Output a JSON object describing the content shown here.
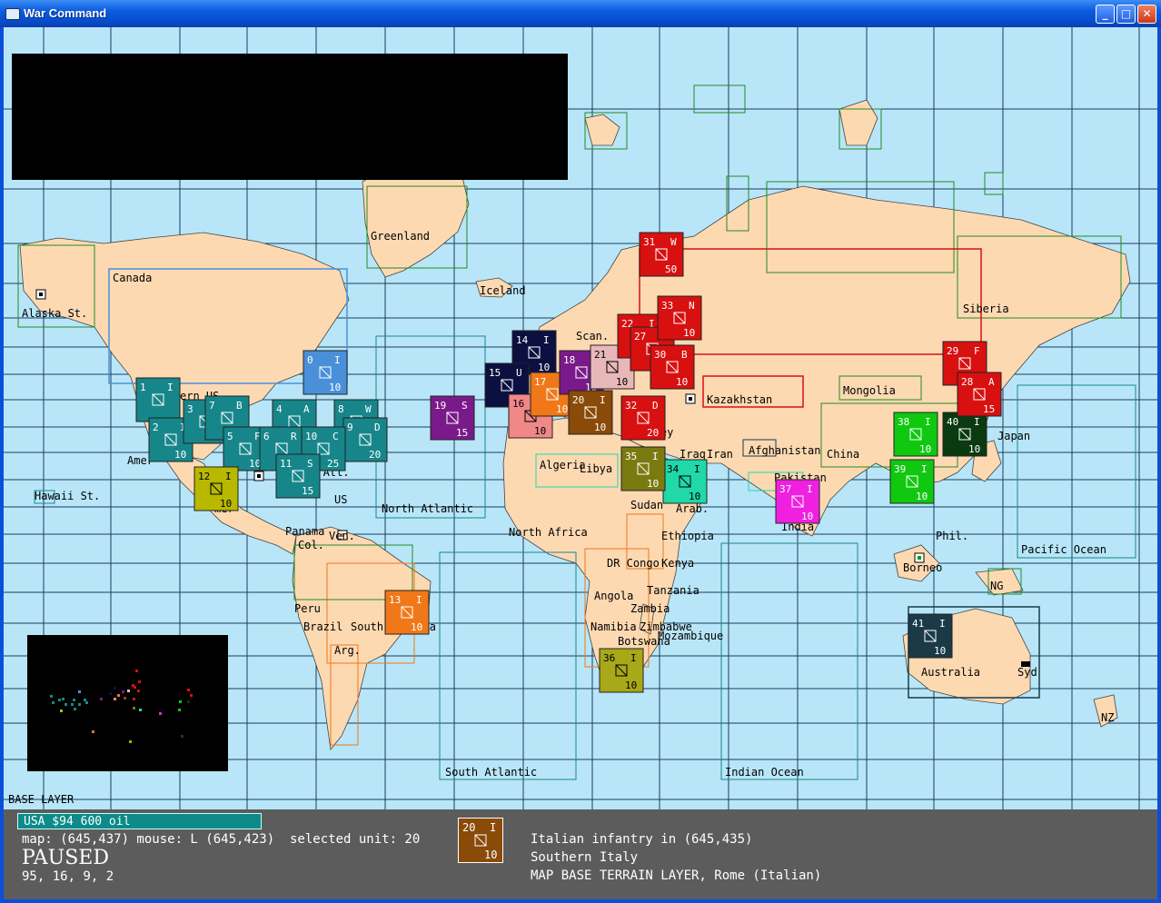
{
  "window": {
    "title": "War Command",
    "minimize": "_",
    "maximize": "□",
    "close": "✕",
    "icon": "app-window-icon"
  },
  "map": {
    "layer_label": "BASE LAYER",
    "regions": [
      "Greenland",
      "Iceland",
      "Canada",
      "Alaska St.",
      "Hawaii St.",
      "Siberia",
      "Mongolia",
      "Kazakhstan",
      "China",
      "Japan",
      "Scan.",
      "Algeria",
      "Libya",
      "Turkey",
      "Iraq",
      "Iran",
      "Afghanistan",
      "Pakistan",
      "India",
      "Arab.",
      "Sudan",
      "North Africa",
      "Ethiopia",
      "DR Congo",
      "Kenya",
      "Tanzania",
      "Angola",
      "Zambia",
      "Namibia",
      "Zimbabwe",
      "Botswana",
      "Mozambique",
      "Cuba",
      "US",
      "Panama",
      "Ven.",
      "Col.",
      "Peru",
      "Brazil",
      "South America",
      "Arg.",
      "Phil.",
      "Borneo",
      "NG",
      "Australia",
      "Syd",
      "NZ",
      "North Atlantic",
      "South Atlantic",
      "Indian Ocean",
      "Pacific Ocean",
      "st Atl.",
      "ern US",
      "Amer",
      "mer"
    ],
    "units": [
      {
        "id": "0",
        "type": "I",
        "strength": "10",
        "color": "#4a90d9"
      },
      {
        "id": "1",
        "type": "I",
        "strength": "",
        "color": "#17868a"
      },
      {
        "id": "2",
        "type": "I",
        "strength": "10",
        "color": "#17868a"
      },
      {
        "id": "3",
        "type": "",
        "strength": "",
        "color": "#17868a"
      },
      {
        "id": "7",
        "type": "B",
        "strength": "10",
        "color": "#17868a"
      },
      {
        "id": "5",
        "type": "F",
        "strength": "10",
        "color": "#17868a"
      },
      {
        "id": "4",
        "type": "A",
        "strength": "",
        "color": "#17868a"
      },
      {
        "id": "6",
        "type": "R",
        "strength": "10",
        "color": "#17868a"
      },
      {
        "id": "8",
        "type": "W",
        "strength": "",
        "color": "#17868a"
      },
      {
        "id": "9",
        "type": "D",
        "strength": "20",
        "color": "#17868a"
      },
      {
        "id": "10",
        "type": "C",
        "strength": "25",
        "color": "#17868a"
      },
      {
        "id": "11",
        "type": "S",
        "strength": "15",
        "color": "#17868a"
      },
      {
        "id": "12",
        "type": "I",
        "strength": "10",
        "color": "#b8b800"
      },
      {
        "id": "13",
        "type": "I",
        "strength": "10",
        "color": "#f07818"
      },
      {
        "id": "14",
        "type": "I",
        "strength": "10",
        "color": "#0c1040"
      },
      {
        "id": "15",
        "type": "U",
        "strength": "50",
        "color": "#0c1040"
      },
      {
        "id": "16",
        "type": "I",
        "strength": "10",
        "color": "#f08888"
      },
      {
        "id": "17",
        "type": "A",
        "strength": "10",
        "color": "#f07818"
      },
      {
        "id": "18",
        "type": "I",
        "strength": "10",
        "color": "#7a1a8a"
      },
      {
        "id": "19",
        "type": "S",
        "strength": "15",
        "color": "#7a1a8a"
      },
      {
        "id": "20",
        "type": "I",
        "strength": "10",
        "color": "#8a4a08"
      },
      {
        "id": "21",
        "type": "I",
        "strength": "10",
        "color": "#e8b8b8"
      },
      {
        "id": "22",
        "type": "I",
        "strength": "",
        "color": "#d81010"
      },
      {
        "id": "27",
        "type": "I",
        "strength": "",
        "color": "#d81010"
      },
      {
        "id": "30",
        "type": "B",
        "strength": "10",
        "color": "#d81010"
      },
      {
        "id": "31",
        "type": "W",
        "strength": "50",
        "color": "#d81010"
      },
      {
        "id": "32",
        "type": "D",
        "strength": "20",
        "color": "#d81010"
      },
      {
        "id": "33",
        "type": "N",
        "strength": "10",
        "color": "#d81010"
      },
      {
        "id": "34",
        "type": "I",
        "strength": "10",
        "color": "#20d8a8"
      },
      {
        "id": "35",
        "type": "I",
        "strength": "10",
        "color": "#7a7a10"
      },
      {
        "id": "36",
        "type": "I",
        "strength": "10",
        "color": "#a8a818"
      },
      {
        "id": "37",
        "type": "I",
        "strength": "10",
        "color": "#f020e0"
      },
      {
        "id": "38",
        "type": "I",
        "strength": "10",
        "color": "#10c810"
      },
      {
        "id": "39",
        "type": "I",
        "strength": "10",
        "color": "#10c810"
      },
      {
        "id": "40",
        "type": "I",
        "strength": "10",
        "color": "#0a3a10"
      },
      {
        "id": "41",
        "type": "I",
        "strength": "10",
        "color": "#1a3a48"
      },
      {
        "id": "29",
        "type": "F",
        "strength": "10",
        "color": "#d81010"
      },
      {
        "id": "28",
        "type": "A",
        "strength": "15",
        "color": "#d81010"
      }
    ]
  },
  "status": {
    "resources": "USA  $94  600 oil",
    "map_info": "map: (645,437) mouse: L (645,423)  selected unit: 20",
    "paused": "PAUSED",
    "numbers": "95, 16, 9, 2",
    "selected": {
      "id": "20",
      "type": "I",
      "strength": "10",
      "color": "#8a4a08"
    },
    "desc_line1": "Italian infantry in (645,435)",
    "desc_line2": "Southern Italy",
    "desc_line3": "MAP BASE TERRAIN LAYER, Rome (Italian)"
  }
}
